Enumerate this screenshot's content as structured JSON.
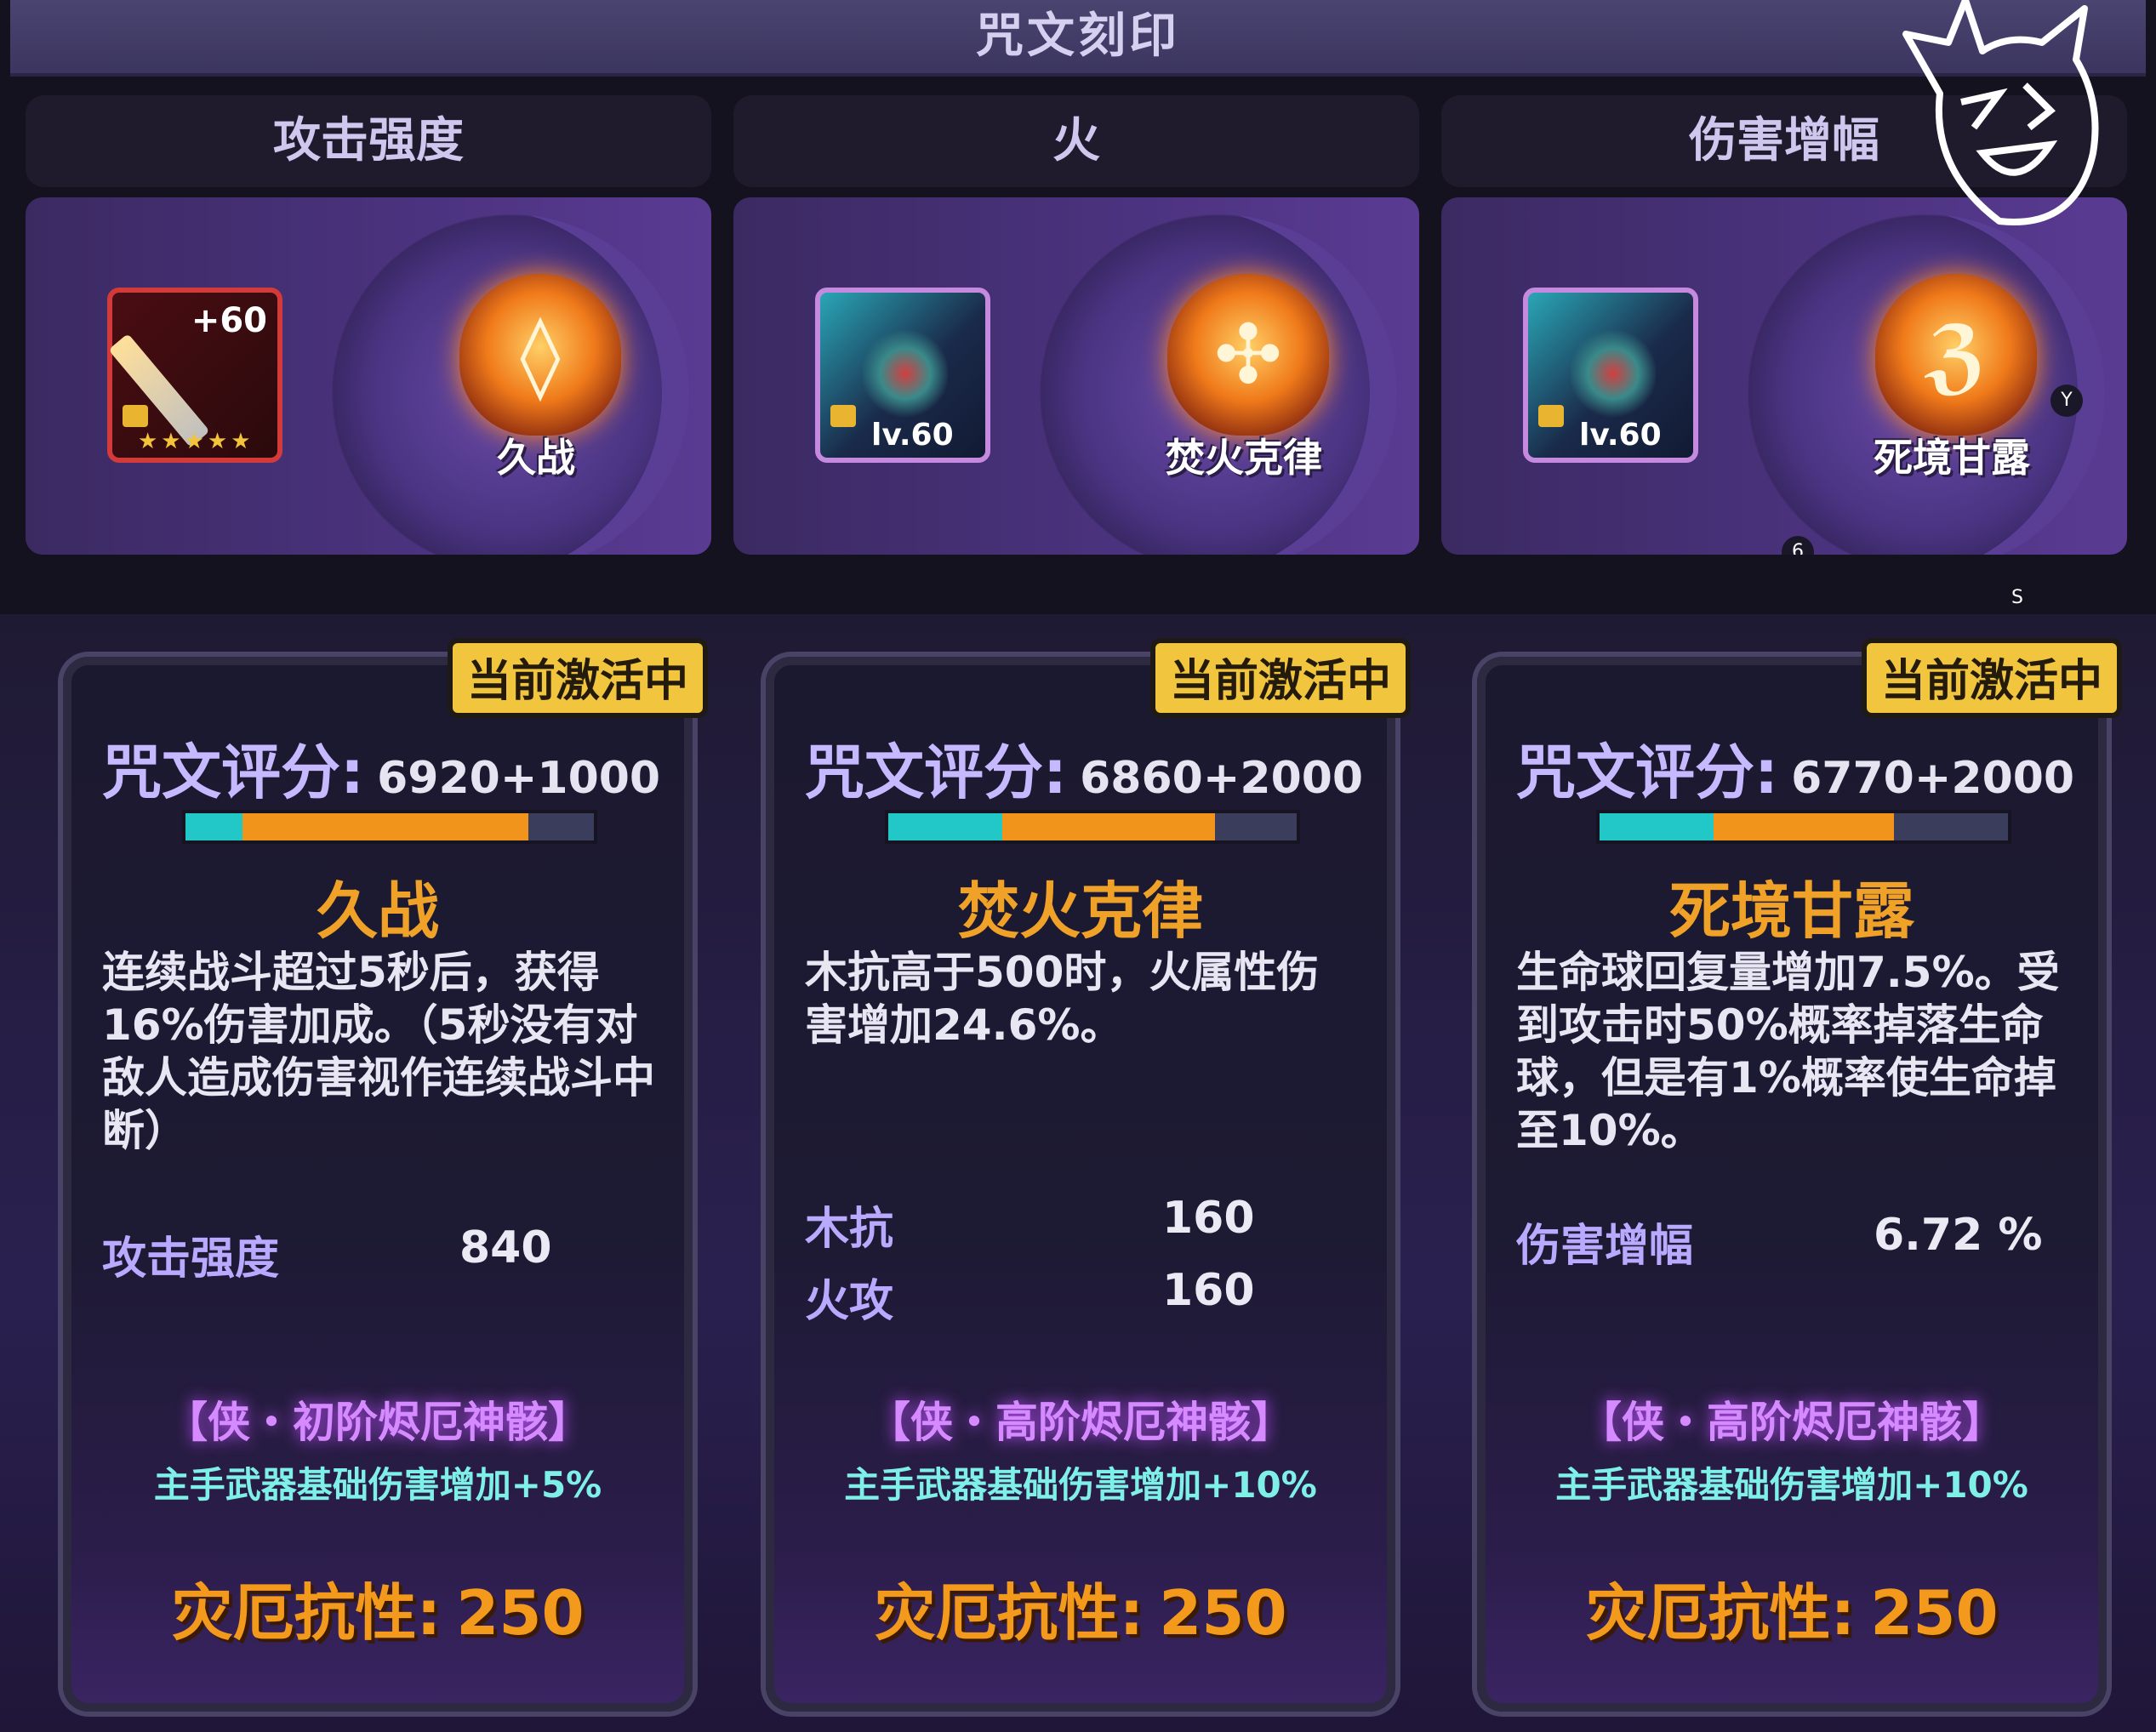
{
  "header": {
    "title": "咒文刻印"
  },
  "columns": [
    {
      "head": "攻击强度",
      "item": {
        "type": "sword",
        "plus": "+60",
        "stars": "★★★★★"
      },
      "rune_name": "久战",
      "gem_glyph": "◊"
    },
    {
      "head": "火",
      "item": {
        "type": "wing",
        "level": "lv.60"
      },
      "rune_name": "焚火克律",
      "gem_glyph": "✣"
    },
    {
      "head": "伤害增幅",
      "item": {
        "type": "wing",
        "level": "lv.60"
      },
      "rune_name": "死境甘露",
      "gem_glyph": "ℨ",
      "badges": [
        "Y",
        "6",
        "S"
      ]
    }
  ],
  "cards": [
    {
      "tag": "当前激活中",
      "score_label": "咒文评分:",
      "score_value": "6920+1000",
      "bar": {
        "teal": 0.14,
        "orange": 0.7
      },
      "title": "久战",
      "description": "连续战斗超过5秒后，获得16%伤害加成。（5秒没有对敌人造成伤害视作连续战斗中断）",
      "stats": [
        {
          "k": "攻击强度",
          "v": "840"
        }
      ],
      "set_name": "【侠・初阶烬厄神骸】",
      "set_bonus": "主手武器基础伤害增加+5%",
      "resist_label": "灾厄抗性:",
      "resist_value": "250"
    },
    {
      "tag": "当前激活中",
      "score_label": "咒文评分:",
      "score_value": "6860+2000",
      "bar": {
        "teal": 0.28,
        "orange": 0.52
      },
      "title": "焚火克律",
      "description": "木抗高于500时，火属性伤害增加24.6%。",
      "stats": [
        {
          "k": "木抗",
          "v": "160"
        },
        {
          "k": "火攻",
          "v": "160"
        }
      ],
      "set_name": "【侠・高阶烬厄神骸】",
      "set_bonus": "主手武器基础伤害增加+10%",
      "resist_label": "灾厄抗性:",
      "resist_value": "250"
    },
    {
      "tag": "当前激活中",
      "score_label": "咒文评分:",
      "score_value": "6770+2000",
      "bar": {
        "teal": 0.28,
        "orange": 0.44
      },
      "title": "死境甘露",
      "description": "生命球回复量增加7.5%。受到攻击时50%概率掉落生命球，但是有1%概率使生命掉至10%。",
      "stats": [
        {
          "k": "伤害增幅",
          "v": "6.72 %"
        }
      ],
      "set_name": "【侠・高阶烬厄神骸】",
      "set_bonus": "主手武器基础伤害增加+10%",
      "resist_label": "灾厄抗性:",
      "resist_value": "250"
    }
  ]
}
